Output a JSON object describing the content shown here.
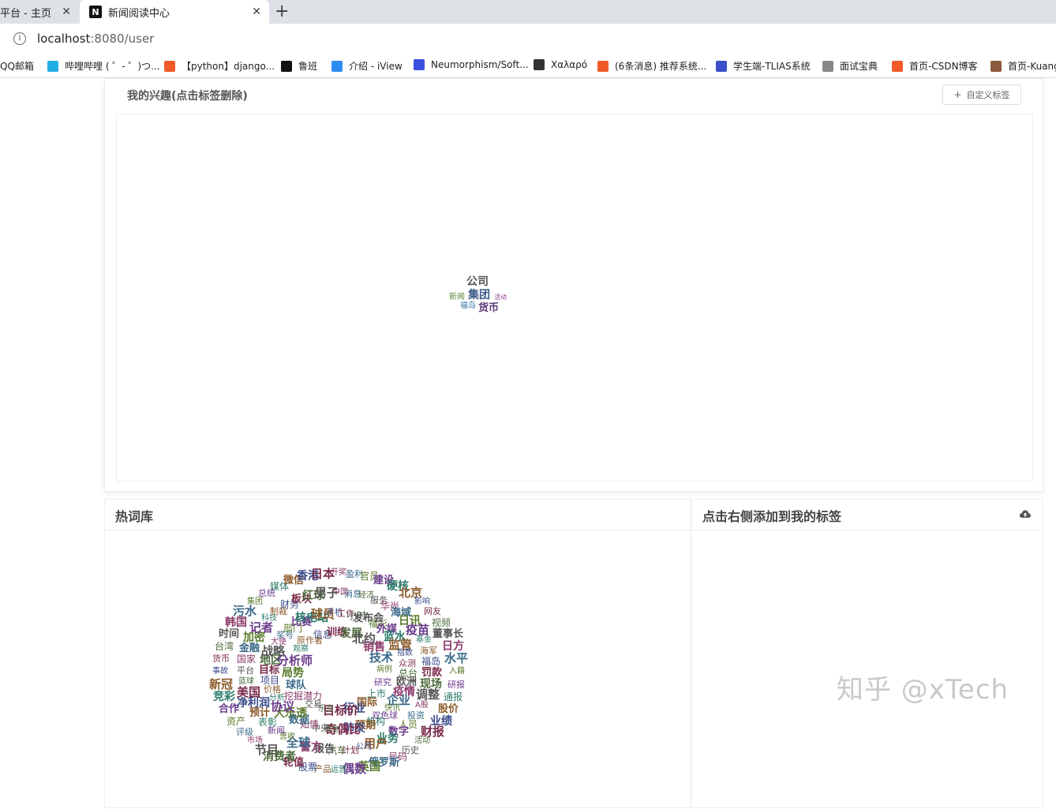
{
  "browser": {
    "tabs": [
      {
        "title": "平台 - 主页",
        "active": false
      },
      {
        "title": "新闻阅读中心",
        "active": true,
        "favicon": "N"
      }
    ],
    "new_tab_label": "+",
    "close_glyph": "✕",
    "url_host": "localhost",
    "url_path": ":8080/user",
    "bookmarks": [
      {
        "label": "QQ邮箱",
        "icon": "mail-icon",
        "color": "#ffffff"
      },
      {
        "label": "哔哩哔哩 ( ゜- ゜)つ...",
        "icon": "bilibili-icon",
        "color": "#23ade5"
      },
      {
        "label": "【python】django...",
        "icon": "csdn-icon",
        "color": "#f05a28"
      },
      {
        "label": "鲁班",
        "icon": "luban-icon",
        "color": "#111111"
      },
      {
        "label": "介绍 - iView",
        "icon": "iview-icon",
        "color": "#2d8cf0"
      },
      {
        "label": "Neumorphism/Soft...",
        "icon": "neumorphism-icon",
        "color": "#3b4fe0"
      },
      {
        "label": "Χαλαρό",
        "icon": "figure-icon",
        "color": "#333333"
      },
      {
        "label": "(6条消息) 推荐系统...",
        "icon": "csdn-icon",
        "color": "#f05a28"
      },
      {
        "label": "学生端-TLIAS系统",
        "icon": "tlias-icon",
        "color": "#3a4fc8"
      },
      {
        "label": "面试宝典",
        "icon": "interview-icon",
        "color": "#888888"
      },
      {
        "label": "首页-CSDN博客",
        "icon": "csdn-icon",
        "color": "#f05a28"
      },
      {
        "label": "首页-Kuang",
        "icon": "avatar-icon",
        "color": "#8a5a3a"
      }
    ]
  },
  "interest": {
    "title": "我的兴趣(点击标签删除)",
    "custom_tag_button": "自定义标签",
    "plus_glyph": "+",
    "words": [
      {
        "text": "公司",
        "color": "#555555"
      },
      {
        "text": "新闻",
        "color": "#5a8a3a"
      },
      {
        "text": "集团",
        "color": "#3a5a8a"
      },
      {
        "text": "活动",
        "color": "#8a3a8a"
      },
      {
        "text": "福岛",
        "color": "#3a7aaa"
      },
      {
        "text": "货币",
        "color": "#5a3a7a"
      }
    ]
  },
  "hot_words": {
    "title": "热词库",
    "words": [
      "开奖",
      "盈利",
      "官员",
      "建设",
      "硬核",
      "北京",
      "影响",
      "网友",
      "视频",
      "董事长",
      "日方",
      "水平",
      "入籍",
      "研报",
      "通报",
      "股价",
      "业绩",
      "财报",
      "活动",
      "历史",
      "号码",
      "俄罗斯",
      "英国",
      "偶数",
      "运营",
      "产品",
      "股票",
      "轮值",
      "消费者",
      "节目",
      "市场",
      "评级",
      "资产",
      "合作",
      "竞彩",
      "新冠",
      "事故",
      "货币",
      "台湾",
      "时间",
      "韩国",
      "污水",
      "集团",
      "总统",
      "媒体",
      "微信",
      "香港",
      "日本",
      "经济",
      "服务",
      "华尚",
      "海域",
      "日讯",
      "疫苗",
      "基金",
      "海军",
      "福岛",
      "罚款",
      "现场",
      "调整",
      "A股",
      "投资",
      "人员",
      "数字",
      "业务",
      "用户",
      "公司",
      "计划",
      "汽车",
      "报告",
      "警方",
      "全球",
      "营收",
      "新闻",
      "表彰",
      "预计",
      "净利润",
      "美国",
      "蓝球",
      "平台",
      "国家",
      "金融",
      "加密",
      "记者",
      "科技",
      "制裁",
      "财务",
      "板块",
      "红球",
      "男子",
      "中国",
      "消息",
      "福彩",
      "外媒",
      "蓝水",
      "监管",
      "指数",
      "众测",
      "总台",
      "欧洲",
      "疫情",
      "企业",
      "快讯",
      "双色球",
      "机构",
      "预期",
      "肺炎",
      "奇偶比",
      "资金",
      "中央",
      "知情",
      "数据",
      "大乐透",
      "协议",
      "分析",
      "价格",
      "项目",
      "目标",
      "地区",
      "战略",
      "大使",
      "奖号",
      "部门",
      "比赛",
      "核电站",
      "球员",
      "手机",
      "工作",
      "小时",
      "发布会",
      "销售",
      "技术",
      "病例",
      "研究",
      "上市",
      "国际",
      "行业",
      "目标价",
      "乐京",
      "交易",
      "挖掘潜力",
      "球队",
      "局势",
      "分析师",
      "观察",
      "原作者",
      "信息",
      "训练",
      "发展",
      "北约"
    ]
  },
  "add_tags": {
    "title": "点击右侧添加到我的标签"
  },
  "watermark": "知乎 @xTech"
}
